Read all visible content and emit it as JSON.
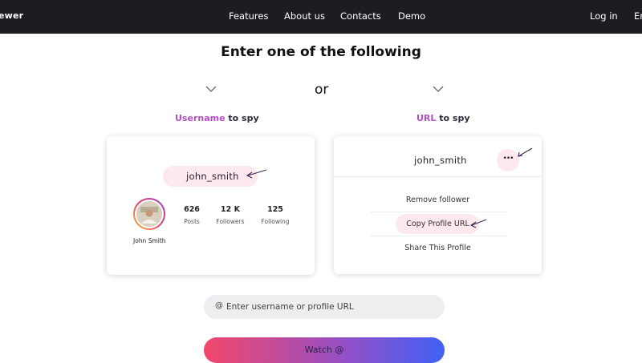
{
  "header": {
    "logo_text": "ewer",
    "nav": [
      "Features",
      "About us",
      "Contacts",
      "Demo"
    ],
    "login": "Log in",
    "lang": "En"
  },
  "main": {
    "title": "Enter one of the following",
    "or": "or",
    "left_label": {
      "accent": "Username",
      "rest": " to spy"
    },
    "right_label": {
      "accent": "URL",
      "rest": " to spy"
    }
  },
  "left_card": {
    "username": "john_smith",
    "profile_name": "John Smith",
    "stats": [
      {
        "value": "626",
        "label": "Posts"
      },
      {
        "value": "12 K",
        "label": "Followers"
      },
      {
        "value": "125",
        "label": "Following"
      }
    ]
  },
  "right_card": {
    "username": "john_smith",
    "more": "•••",
    "menu": [
      "Remove follower",
      "Copy Profile URL",
      "Share This Profile"
    ]
  },
  "search": {
    "at": "@",
    "placeholder": "Enter username or profile URL",
    "value": ""
  },
  "cta": {
    "label": "Watch @"
  },
  "colors": {
    "topbar": "#1c1d22",
    "accent_pink": "#f2476a",
    "accent_blue": "#3f61f5",
    "pill": "#fde8ee"
  },
  "icons": [
    "chevron-down-icon",
    "chevron-down-icon",
    "more-options-icon",
    "arrow-annotation-icon",
    "avatar"
  ]
}
